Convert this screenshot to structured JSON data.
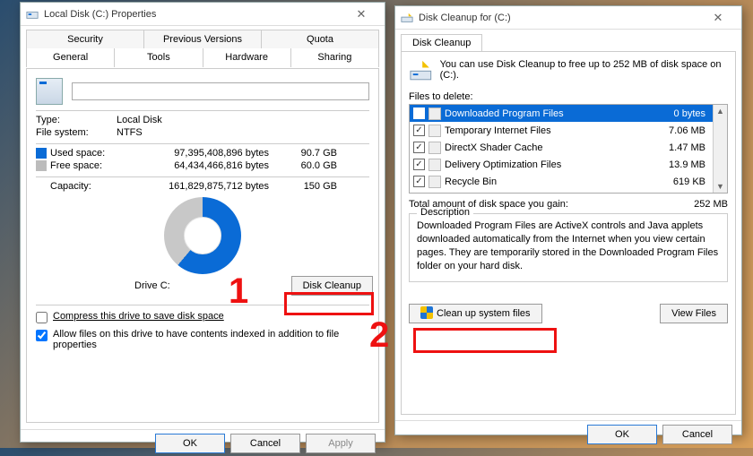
{
  "prop": {
    "title": "Local Disk (C:) Properties",
    "tabsTop": [
      "Security",
      "Previous Versions",
      "Quota"
    ],
    "tabsBottom": [
      "General",
      "Tools",
      "Hardware",
      "Sharing"
    ],
    "type_label": "Type:",
    "type_value": "Local Disk",
    "fs_label": "File system:",
    "fs_value": "NTFS",
    "used_label": "Used space:",
    "used_bytes": "97,395,408,896 bytes",
    "used_gb": "90.7 GB",
    "free_label": "Free space:",
    "free_bytes": "64,434,466,816 bytes",
    "free_gb": "60.0 GB",
    "cap_label": "Capacity:",
    "cap_bytes": "161,829,875,712 bytes",
    "cap_gb": "150 GB",
    "drive_label": "Drive C:",
    "cleanup_btn": "Disk Cleanup",
    "compress": "Compress this drive to save disk space",
    "index": "Allow files on this drive to have contents indexed in addition to file properties",
    "ok": "OK",
    "cancel": "Cancel",
    "apply": "Apply"
  },
  "dc": {
    "title": "Disk Cleanup for  (C:)",
    "tab": "Disk Cleanup",
    "intro": "You can use Disk Cleanup to free up to 252 MB of disk space on (C:).",
    "files_label": "Files to delete:",
    "items": [
      {
        "name": "Downloaded Program Files",
        "size": "0 bytes",
        "checked": false,
        "selected": true,
        "icon": "folder"
      },
      {
        "name": "Temporary Internet Files",
        "size": "7.06 MB",
        "checked": true,
        "icon": "lock"
      },
      {
        "name": "DirectX Shader Cache",
        "size": "1.47 MB",
        "checked": true,
        "icon": "file"
      },
      {
        "name": "Delivery Optimization Files",
        "size": "13.9 MB",
        "checked": true,
        "icon": "file"
      },
      {
        "name": "Recycle Bin",
        "size": "619 KB",
        "checked": true,
        "icon": "bin"
      }
    ],
    "total_label": "Total amount of disk space you gain:",
    "total_value": "252 MB",
    "desc_label": "Description",
    "desc": "Downloaded Program Files are ActiveX controls and Java applets downloaded automatically from the Internet when you view certain pages. They are temporarily stored in the Downloaded Program Files folder on your hard disk.",
    "cleanup_sys": "Clean up system files",
    "view_files": "View Files",
    "ok": "OK",
    "cancel": "Cancel"
  },
  "annot": {
    "one": "1",
    "two": "2"
  }
}
